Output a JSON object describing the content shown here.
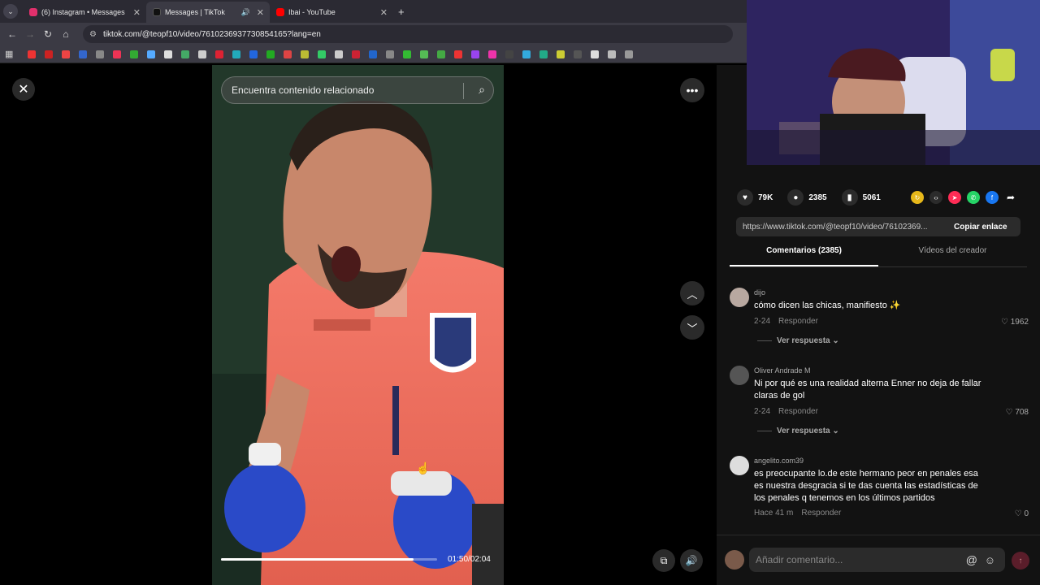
{
  "browser": {
    "tabs": [
      {
        "title": "(6) Instagram • Messages",
        "fav_color": "#e1306c",
        "active": false
      },
      {
        "title": "Messages | TikTok",
        "fav_color": "#111111",
        "active": true
      },
      {
        "title": "Ibai - YouTube",
        "fav_color": "#ff0000",
        "active": false
      }
    ],
    "new_tab": "+",
    "url": "tiktok.com/@teopf10/video/7610236937730854165?lang=en"
  },
  "video": {
    "search_placeholder": "Encuentra contenido relacionado",
    "time": "01:50/02:04",
    "progress": 0.89
  },
  "actions": {
    "likes": "79K",
    "comments": "2385",
    "saves": "5061"
  },
  "link": {
    "url": "https://www.tiktok.com/@teopf10/video/76102369...",
    "copy_label": "Copiar enlace"
  },
  "tabs": {
    "comments_label": "Comentarios (2385)",
    "creator_label": "Vídeos del creador"
  },
  "comments": [
    {
      "user": "dijo",
      "text": "cómo dicen las chicas, manifiesto ✨",
      "date": "2-24",
      "reply": "Responder",
      "likes": "1962",
      "view_replies": "Ver respuesta ⌄"
    },
    {
      "user": "Oliver Andrade M",
      "text": "Ni por qué es una realidad alterna Enner no deja de fallar claras de gol",
      "date": "2-24",
      "reply": "Responder",
      "likes": "708",
      "view_replies": "Ver respuesta ⌄"
    },
    {
      "user": "angelito.com39",
      "text": "es preocupante lo.de este hermano peor en penales esa es nuestra desgracia si te das cuenta las estadísticas de los penales q tenemos en los últimos partidos",
      "date": "Hace 41 m",
      "reply": "Responder",
      "likes": "0"
    }
  ],
  "composer": {
    "placeholder": "Añadir comentario..."
  }
}
